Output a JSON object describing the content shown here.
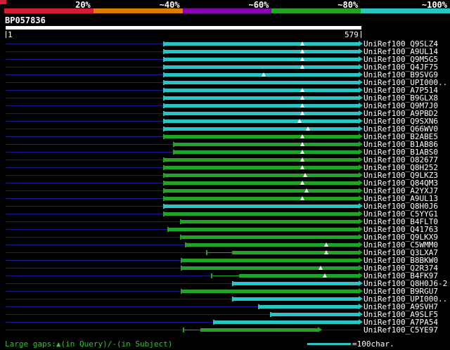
{
  "header": {
    "scale_labels": [
      "20%",
      "~40%",
      "~60%",
      "~80%",
      "~100%"
    ],
    "scale_colors": [
      "#d81b34",
      "#dd7a00",
      "#8a00b0",
      "#21a421",
      "#29c5c5"
    ],
    "query_name": "BP057836",
    "ruler_start": "1",
    "ruler_end": "579"
  },
  "footer": {
    "gaps_legend": "Large gaps:▲(in Query)/-(in Subject)",
    "scale_legend": "=100char."
  },
  "colors": {
    "cyan": "#29c5c5",
    "green": "#21a421",
    "row_line": "#1b1b85",
    "query_bar": "#ffffff",
    "triangle": "#ffffff",
    "legend_text": "#2fc22f",
    "corner_mark": "#d81b34"
  },
  "chart_data": {
    "type": "bar",
    "orientation": "horizontal",
    "title": "BP057836",
    "xlabel": "query position",
    "xlim": [
      1,
      579
    ],
    "legend_position": "top",
    "hits": [
      {
        "label": "UniRef100_Q9SLZ4",
        "bin": "cyan",
        "qstart": 257,
        "qend": 579,
        "gap_marks": [
          483
        ]
      },
      {
        "label": "UniRef100_A9UL14",
        "bin": "cyan",
        "qstart": 257,
        "qend": 579,
        "gap_marks": [
          483
        ]
      },
      {
        "label": "UniRef100_Q9M5G5",
        "bin": "cyan",
        "qstart": 257,
        "qend": 579,
        "gap_marks": [
          483
        ]
      },
      {
        "label": "UniRef100_Q4JF75",
        "bin": "cyan",
        "qstart": 257,
        "qend": 579,
        "gap_marks": [
          483
        ]
      },
      {
        "label": "UniRef100_B9SVG9",
        "bin": "cyan",
        "qstart": 257,
        "qend": 579,
        "gap_marks": [
          420
        ]
      },
      {
        "label": "UniRef100_UPI000..",
        "bin": "cyan",
        "qstart": 257,
        "qend": 579,
        "gap_marks": []
      },
      {
        "label": "UniRef100_A7P514",
        "bin": "cyan",
        "qstart": 257,
        "qend": 579,
        "gap_marks": [
          483
        ]
      },
      {
        "label": "UniRef100_B9GLX8",
        "bin": "cyan",
        "qstart": 257,
        "qend": 579,
        "gap_marks": [
          483
        ]
      },
      {
        "label": "UniRef100_Q9M7J0",
        "bin": "cyan",
        "qstart": 257,
        "qend": 579,
        "gap_marks": [
          483
        ]
      },
      {
        "label": "UniRef100_A9PBD2",
        "bin": "cyan",
        "qstart": 257,
        "qend": 579,
        "gap_marks": [
          483
        ]
      },
      {
        "label": "UniRef100_Q9SXN6",
        "bin": "cyan",
        "qstart": 257,
        "qend": 579,
        "gap_marks": [
          478
        ]
      },
      {
        "label": "UniRef100_Q66WV0",
        "bin": "cyan",
        "qstart": 257,
        "qend": 579,
        "gap_marks": [
          492
        ]
      },
      {
        "label": "UniRef100_B2ABE5",
        "bin": "green",
        "qstart": 257,
        "qend": 579,
        "gap_marks": [
          483
        ]
      },
      {
        "label": "UniRef100_B1AB86",
        "bin": "green",
        "qstart": 273,
        "qend": 579,
        "gap_marks": [
          483
        ]
      },
      {
        "label": "UniRef100_B1ABS0",
        "bin": "green",
        "qstart": 273,
        "qend": 579,
        "gap_marks": [
          483
        ]
      },
      {
        "label": "UniRef100_O82677",
        "bin": "green",
        "qstart": 257,
        "qend": 579,
        "gap_marks": [
          483
        ]
      },
      {
        "label": "UniRef100_Q8H252",
        "bin": "green",
        "qstart": 257,
        "qend": 579,
        "gap_marks": [
          483
        ]
      },
      {
        "label": "UniRef100_Q9LKZ3",
        "bin": "green",
        "qstart": 257,
        "qend": 579,
        "gap_marks": [
          488
        ]
      },
      {
        "label": "UniRef100_Q84QM3",
        "bin": "green",
        "qstart": 257,
        "qend": 579,
        "gap_marks": [
          483
        ]
      },
      {
        "label": "UniRef100_A2YXJ7",
        "bin": "green",
        "qstart": 257,
        "qend": 579,
        "gap_marks": [
          490
        ]
      },
      {
        "label": "UniRef100_A9UL13",
        "bin": "green",
        "qstart": 257,
        "qend": 579,
        "gap_marks": [
          483
        ]
      },
      {
        "label": "UniRef100_Q8H0J6",
        "bin": "cyan",
        "qstart": 257,
        "qend": 579,
        "gap_marks": []
      },
      {
        "label": "UniRef100_C5YYG1",
        "bin": "green",
        "qstart": 257,
        "qend": 579,
        "gap_marks": []
      },
      {
        "label": "UniRef100_B4FLT0",
        "bin": "green",
        "qstart": 284,
        "qend": 579,
        "gap_marks": []
      },
      {
        "label": "UniRef100_Q41763",
        "bin": "green",
        "qstart": 264,
        "qend": 579,
        "gap_marks": []
      },
      {
        "label": "UniRef100_Q9LKX9",
        "bin": "green",
        "qstart": 284,
        "qend": 579,
        "gap_marks": []
      },
      {
        "label": "UniRef100_C5WMM0",
        "bin": "green",
        "qstart": 292,
        "qend": 579,
        "gap_marks": [
          522
        ]
      },
      {
        "label": "UniRef100_Q3LXA7",
        "bin": "green",
        "qstart": 326,
        "qend": 579,
        "thin_until": 369,
        "gap_marks": [
          522
        ]
      },
      {
        "label": "UniRef100_B8BKW0",
        "bin": "green",
        "qstart": 285,
        "qend": 579,
        "gap_marks": []
      },
      {
        "label": "UniRef100_Q2R374",
        "bin": "green",
        "qstart": 285,
        "qend": 579,
        "gap_marks": [
          513
        ]
      },
      {
        "label": "UniRef100_B4FK97",
        "bin": "green",
        "qstart": 334,
        "qend": 579,
        "thin_until": 380,
        "gap_marks": [
          520
        ]
      },
      {
        "label": "UniRef100_Q8H0J6-2",
        "bin": "cyan",
        "qstart": 369,
        "qend": 579,
        "gap_marks": []
      },
      {
        "label": "UniRef100_B9RGU7",
        "bin": "green",
        "qstart": 286,
        "qend": 579,
        "gap_marks": []
      },
      {
        "label": "UniRef100_UPI000..",
        "bin": "cyan",
        "qstart": 369,
        "qend": 579,
        "gap_marks": []
      },
      {
        "label": "UniRef100_A9SVH7",
        "bin": "cyan",
        "qstart": 411,
        "qend": 579,
        "gap_marks": []
      },
      {
        "label": "UniRef100_A9SLF5",
        "bin": "cyan",
        "qstart": 431,
        "qend": 579,
        "gap_marks": []
      },
      {
        "label": "UniRef100_A7PA54",
        "bin": "cyan",
        "qstart": 338,
        "qend": 579,
        "gap_marks": []
      },
      {
        "label": "UniRef100_C5YE97",
        "bin": "green",
        "qstart": 289,
        "qend": 513,
        "thin_until": 317,
        "gap_marks": []
      }
    ]
  }
}
